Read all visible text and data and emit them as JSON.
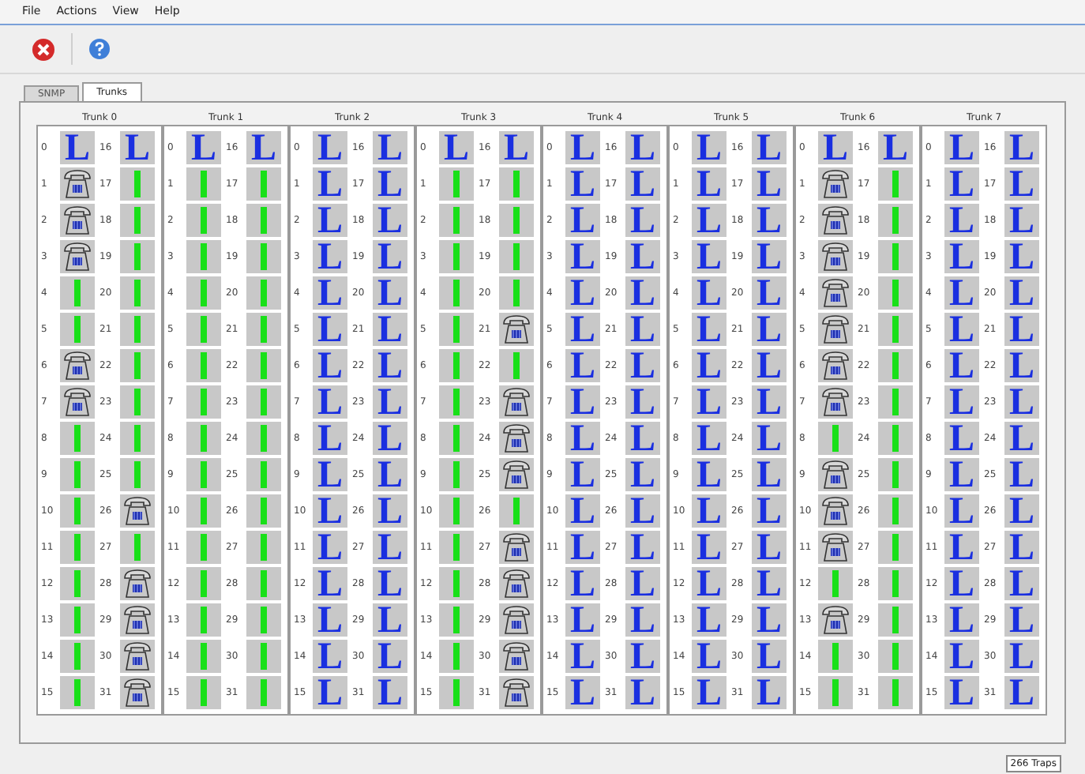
{
  "menu": [
    "File",
    "Actions",
    "View",
    "Help"
  ],
  "tabs": [
    {
      "label": "SNMP",
      "selected": false
    },
    {
      "label": "Trunks",
      "selected": true
    }
  ],
  "trunks": [
    {
      "name": "Trunk 0",
      "channels": [
        {
          "number": "0",
          "kind": "blocked",
          "glyph": "L"
        },
        {
          "number": "1",
          "kind": "phone"
        },
        {
          "number": "2",
          "kind": "phone"
        },
        {
          "number": "3",
          "kind": "phone"
        },
        {
          "number": "4",
          "kind": "idle"
        },
        {
          "number": "5",
          "kind": "idle"
        },
        {
          "number": "6",
          "kind": "phone"
        },
        {
          "number": "7",
          "kind": "phone"
        },
        {
          "number": "8",
          "kind": "idle"
        },
        {
          "number": "9",
          "kind": "idle"
        },
        {
          "number": "10",
          "kind": "idle"
        },
        {
          "number": "11",
          "kind": "idle"
        },
        {
          "number": "12",
          "kind": "idle"
        },
        {
          "number": "13",
          "kind": "idle"
        },
        {
          "number": "14",
          "kind": "idle"
        },
        {
          "number": "15",
          "kind": "idle"
        },
        {
          "number": "16",
          "kind": "blocked",
          "glyph": "L"
        },
        {
          "number": "17",
          "kind": "idle"
        },
        {
          "number": "18",
          "kind": "idle"
        },
        {
          "number": "19",
          "kind": "idle"
        },
        {
          "number": "20",
          "kind": "idle"
        },
        {
          "number": "21",
          "kind": "idle"
        },
        {
          "number": "22",
          "kind": "idle"
        },
        {
          "number": "23",
          "kind": "idle"
        },
        {
          "number": "24",
          "kind": "idle"
        },
        {
          "number": "25",
          "kind": "idle"
        },
        {
          "number": "26",
          "kind": "phone"
        },
        {
          "number": "27",
          "kind": "idle"
        },
        {
          "number": "28",
          "kind": "phone"
        },
        {
          "number": "29",
          "kind": "phone"
        },
        {
          "number": "30",
          "kind": "phone"
        },
        {
          "number": "31",
          "kind": "phone"
        }
      ]
    },
    {
      "name": "Trunk 1",
      "channels": [
        {
          "number": "0",
          "kind": "blocked",
          "glyph": "L"
        },
        {
          "number": "1",
          "kind": "idle"
        },
        {
          "number": "2",
          "kind": "idle"
        },
        {
          "number": "3",
          "kind": "idle"
        },
        {
          "number": "4",
          "kind": "idle"
        },
        {
          "number": "5",
          "kind": "idle"
        },
        {
          "number": "6",
          "kind": "idle"
        },
        {
          "number": "7",
          "kind": "idle"
        },
        {
          "number": "8",
          "kind": "idle"
        },
        {
          "number": "9",
          "kind": "idle"
        },
        {
          "number": "10",
          "kind": "idle"
        },
        {
          "number": "11",
          "kind": "idle"
        },
        {
          "number": "12",
          "kind": "idle"
        },
        {
          "number": "13",
          "kind": "idle"
        },
        {
          "number": "14",
          "kind": "idle"
        },
        {
          "number": "15",
          "kind": "idle"
        },
        {
          "number": "16",
          "kind": "blocked",
          "glyph": "L"
        },
        {
          "number": "17",
          "kind": "idle"
        },
        {
          "number": "18",
          "kind": "idle"
        },
        {
          "number": "19",
          "kind": "idle"
        },
        {
          "number": "20",
          "kind": "idle"
        },
        {
          "number": "21",
          "kind": "idle"
        },
        {
          "number": "22",
          "kind": "idle"
        },
        {
          "number": "23",
          "kind": "idle"
        },
        {
          "number": "24",
          "kind": "idle"
        },
        {
          "number": "25",
          "kind": "idle"
        },
        {
          "number": "26",
          "kind": "idle"
        },
        {
          "number": "27",
          "kind": "idle"
        },
        {
          "number": "28",
          "kind": "idle"
        },
        {
          "number": "29",
          "kind": "idle"
        },
        {
          "number": "30",
          "kind": "idle"
        },
        {
          "number": "31",
          "kind": "idle"
        }
      ]
    },
    {
      "name": "Trunk 2",
      "channels": [
        {
          "number": "0",
          "kind": "blocked",
          "glyph": "L"
        },
        {
          "number": "1",
          "kind": "blocked",
          "glyph": "L"
        },
        {
          "number": "2",
          "kind": "blocked",
          "glyph": "L"
        },
        {
          "number": "3",
          "kind": "blocked",
          "glyph": "L"
        },
        {
          "number": "4",
          "kind": "blocked",
          "glyph": "L"
        },
        {
          "number": "5",
          "kind": "blocked",
          "glyph": "L"
        },
        {
          "number": "6",
          "kind": "blocked",
          "glyph": "L"
        },
        {
          "number": "7",
          "kind": "blocked",
          "glyph": "L"
        },
        {
          "number": "8",
          "kind": "blocked",
          "glyph": "L"
        },
        {
          "number": "9",
          "kind": "blocked",
          "glyph": "L"
        },
        {
          "number": "10",
          "kind": "blocked",
          "glyph": "L"
        },
        {
          "number": "11",
          "kind": "blocked",
          "glyph": "L"
        },
        {
          "number": "12",
          "kind": "blocked",
          "glyph": "L"
        },
        {
          "number": "13",
          "kind": "blocked",
          "glyph": "L"
        },
        {
          "number": "14",
          "kind": "blocked",
          "glyph": "L"
        },
        {
          "number": "15",
          "kind": "blocked",
          "glyph": "L"
        },
        {
          "number": "16",
          "kind": "blocked",
          "glyph": "L"
        },
        {
          "number": "17",
          "kind": "blocked",
          "glyph": "L"
        },
        {
          "number": "18",
          "kind": "blocked",
          "glyph": "L"
        },
        {
          "number": "19",
          "kind": "blocked",
          "glyph": "L"
        },
        {
          "number": "20",
          "kind": "blocked",
          "glyph": "L"
        },
        {
          "number": "21",
          "kind": "blocked",
          "glyph": "L"
        },
        {
          "number": "22",
          "kind": "blocked",
          "glyph": "L"
        },
        {
          "number": "23",
          "kind": "blocked",
          "glyph": "L"
        },
        {
          "number": "24",
          "kind": "blocked",
          "glyph": "L"
        },
        {
          "number": "25",
          "kind": "blocked",
          "glyph": "L"
        },
        {
          "number": "26",
          "kind": "blocked",
          "glyph": "L"
        },
        {
          "number": "27",
          "kind": "blocked",
          "glyph": "L"
        },
        {
          "number": "28",
          "kind": "blocked",
          "glyph": "L"
        },
        {
          "number": "29",
          "kind": "blocked",
          "glyph": "L"
        },
        {
          "number": "30",
          "kind": "blocked",
          "glyph": "L"
        },
        {
          "number": "31",
          "kind": "blocked",
          "glyph": "L"
        }
      ]
    },
    {
      "name": "Trunk 3",
      "channels": [
        {
          "number": "0",
          "kind": "blocked",
          "glyph": "L"
        },
        {
          "number": "1",
          "kind": "idle"
        },
        {
          "number": "2",
          "kind": "idle"
        },
        {
          "number": "3",
          "kind": "idle"
        },
        {
          "number": "4",
          "kind": "idle"
        },
        {
          "number": "5",
          "kind": "idle"
        },
        {
          "number": "6",
          "kind": "idle"
        },
        {
          "number": "7",
          "kind": "idle"
        },
        {
          "number": "8",
          "kind": "idle"
        },
        {
          "number": "9",
          "kind": "idle"
        },
        {
          "number": "10",
          "kind": "idle"
        },
        {
          "number": "11",
          "kind": "idle"
        },
        {
          "number": "12",
          "kind": "idle"
        },
        {
          "number": "13",
          "kind": "idle"
        },
        {
          "number": "14",
          "kind": "idle"
        },
        {
          "number": "15",
          "kind": "idle"
        },
        {
          "number": "16",
          "kind": "blocked",
          "glyph": "L"
        },
        {
          "number": "17",
          "kind": "idle"
        },
        {
          "number": "18",
          "kind": "idle"
        },
        {
          "number": "19",
          "kind": "idle"
        },
        {
          "number": "20",
          "kind": "idle"
        },
        {
          "number": "21",
          "kind": "phone"
        },
        {
          "number": "22",
          "kind": "idle"
        },
        {
          "number": "23",
          "kind": "phone"
        },
        {
          "number": "24",
          "kind": "phone"
        },
        {
          "number": "25",
          "kind": "phone"
        },
        {
          "number": "26",
          "kind": "idle"
        },
        {
          "number": "27",
          "kind": "phone"
        },
        {
          "number": "28",
          "kind": "phone"
        },
        {
          "number": "29",
          "kind": "phone"
        },
        {
          "number": "30",
          "kind": "phone"
        },
        {
          "number": "31",
          "kind": "phone"
        }
      ]
    },
    {
      "name": "Trunk 4",
      "channels": [
        {
          "number": "0",
          "kind": "blocked",
          "glyph": "L"
        },
        {
          "number": "1",
          "kind": "blocked",
          "glyph": "L"
        },
        {
          "number": "2",
          "kind": "blocked",
          "glyph": "L"
        },
        {
          "number": "3",
          "kind": "blocked",
          "glyph": "L"
        },
        {
          "number": "4",
          "kind": "blocked",
          "glyph": "L"
        },
        {
          "number": "5",
          "kind": "blocked",
          "glyph": "L"
        },
        {
          "number": "6",
          "kind": "blocked",
          "glyph": "L"
        },
        {
          "number": "7",
          "kind": "blocked",
          "glyph": "L"
        },
        {
          "number": "8",
          "kind": "blocked",
          "glyph": "L"
        },
        {
          "number": "9",
          "kind": "blocked",
          "glyph": "L"
        },
        {
          "number": "10",
          "kind": "blocked",
          "glyph": "L"
        },
        {
          "number": "11",
          "kind": "blocked",
          "glyph": "L"
        },
        {
          "number": "12",
          "kind": "blocked",
          "glyph": "L"
        },
        {
          "number": "13",
          "kind": "blocked",
          "glyph": "L"
        },
        {
          "number": "14",
          "kind": "blocked",
          "glyph": "L"
        },
        {
          "number": "15",
          "kind": "blocked",
          "glyph": "L"
        },
        {
          "number": "16",
          "kind": "blocked",
          "glyph": "L"
        },
        {
          "number": "17",
          "kind": "blocked",
          "glyph": "L"
        },
        {
          "number": "18",
          "kind": "blocked",
          "glyph": "L"
        },
        {
          "number": "19",
          "kind": "blocked",
          "glyph": "L"
        },
        {
          "number": "20",
          "kind": "blocked",
          "glyph": "L"
        },
        {
          "number": "21",
          "kind": "blocked",
          "glyph": "L"
        },
        {
          "number": "22",
          "kind": "blocked",
          "glyph": "L"
        },
        {
          "number": "23",
          "kind": "blocked",
          "glyph": "L"
        },
        {
          "number": "24",
          "kind": "blocked",
          "glyph": "L"
        },
        {
          "number": "25",
          "kind": "blocked",
          "glyph": "L"
        },
        {
          "number": "26",
          "kind": "blocked",
          "glyph": "L"
        },
        {
          "number": "27",
          "kind": "blocked",
          "glyph": "L"
        },
        {
          "number": "28",
          "kind": "blocked",
          "glyph": "L"
        },
        {
          "number": "29",
          "kind": "blocked",
          "glyph": "L"
        },
        {
          "number": "30",
          "kind": "blocked",
          "glyph": "L"
        },
        {
          "number": "31",
          "kind": "blocked",
          "glyph": "L"
        }
      ]
    },
    {
      "name": "Trunk 5",
      "channels": [
        {
          "number": "0",
          "kind": "blocked",
          "glyph": "L"
        },
        {
          "number": "1",
          "kind": "blocked",
          "glyph": "L"
        },
        {
          "number": "2",
          "kind": "blocked",
          "glyph": "L"
        },
        {
          "number": "3",
          "kind": "blocked",
          "glyph": "L"
        },
        {
          "number": "4",
          "kind": "blocked",
          "glyph": "L"
        },
        {
          "number": "5",
          "kind": "blocked",
          "glyph": "L"
        },
        {
          "number": "6",
          "kind": "blocked",
          "glyph": "L"
        },
        {
          "number": "7",
          "kind": "blocked",
          "glyph": "L"
        },
        {
          "number": "8",
          "kind": "blocked",
          "glyph": "L"
        },
        {
          "number": "9",
          "kind": "blocked",
          "glyph": "L"
        },
        {
          "number": "10",
          "kind": "blocked",
          "glyph": "L"
        },
        {
          "number": "11",
          "kind": "blocked",
          "glyph": "L"
        },
        {
          "number": "12",
          "kind": "blocked",
          "glyph": "L"
        },
        {
          "number": "13",
          "kind": "blocked",
          "glyph": "L"
        },
        {
          "number": "14",
          "kind": "blocked",
          "glyph": "L"
        },
        {
          "number": "15",
          "kind": "blocked",
          "glyph": "L"
        },
        {
          "number": "16",
          "kind": "blocked",
          "glyph": "L"
        },
        {
          "number": "17",
          "kind": "blocked",
          "glyph": "L"
        },
        {
          "number": "18",
          "kind": "blocked",
          "glyph": "L"
        },
        {
          "number": "19",
          "kind": "blocked",
          "glyph": "L"
        },
        {
          "number": "20",
          "kind": "blocked",
          "glyph": "L"
        },
        {
          "number": "21",
          "kind": "blocked",
          "glyph": "L"
        },
        {
          "number": "22",
          "kind": "blocked",
          "glyph": "L"
        },
        {
          "number": "23",
          "kind": "blocked",
          "glyph": "L"
        },
        {
          "number": "24",
          "kind": "blocked",
          "glyph": "L"
        },
        {
          "number": "25",
          "kind": "blocked",
          "glyph": "L"
        },
        {
          "number": "26",
          "kind": "blocked",
          "glyph": "L"
        },
        {
          "number": "27",
          "kind": "blocked",
          "glyph": "L"
        },
        {
          "number": "28",
          "kind": "blocked",
          "glyph": "L"
        },
        {
          "number": "29",
          "kind": "blocked",
          "glyph": "L"
        },
        {
          "number": "30",
          "kind": "blocked",
          "glyph": "L"
        },
        {
          "number": "31",
          "kind": "blocked",
          "glyph": "L"
        }
      ]
    },
    {
      "name": "Trunk 6",
      "channels": [
        {
          "number": "0",
          "kind": "blocked",
          "glyph": "L"
        },
        {
          "number": "1",
          "kind": "phone"
        },
        {
          "number": "2",
          "kind": "phone"
        },
        {
          "number": "3",
          "kind": "phone"
        },
        {
          "number": "4",
          "kind": "phone"
        },
        {
          "number": "5",
          "kind": "phone"
        },
        {
          "number": "6",
          "kind": "phone"
        },
        {
          "number": "7",
          "kind": "phone"
        },
        {
          "number": "8",
          "kind": "idle"
        },
        {
          "number": "9",
          "kind": "phone"
        },
        {
          "number": "10",
          "kind": "phone"
        },
        {
          "number": "11",
          "kind": "phone"
        },
        {
          "number": "12",
          "kind": "idle"
        },
        {
          "number": "13",
          "kind": "phone"
        },
        {
          "number": "14",
          "kind": "idle"
        },
        {
          "number": "15",
          "kind": "idle"
        },
        {
          "number": "16",
          "kind": "blocked",
          "glyph": "L"
        },
        {
          "number": "17",
          "kind": "idle"
        },
        {
          "number": "18",
          "kind": "idle"
        },
        {
          "number": "19",
          "kind": "idle"
        },
        {
          "number": "20",
          "kind": "idle"
        },
        {
          "number": "21",
          "kind": "idle"
        },
        {
          "number": "22",
          "kind": "idle"
        },
        {
          "number": "23",
          "kind": "idle"
        },
        {
          "number": "24",
          "kind": "idle"
        },
        {
          "number": "25",
          "kind": "idle"
        },
        {
          "number": "26",
          "kind": "idle"
        },
        {
          "number": "27",
          "kind": "idle"
        },
        {
          "number": "28",
          "kind": "idle"
        },
        {
          "number": "29",
          "kind": "idle"
        },
        {
          "number": "30",
          "kind": "idle"
        },
        {
          "number": "31",
          "kind": "idle"
        }
      ]
    },
    {
      "name": "Trunk 7",
      "channels": [
        {
          "number": "0",
          "kind": "blocked",
          "glyph": "L"
        },
        {
          "number": "1",
          "kind": "blocked",
          "glyph": "L"
        },
        {
          "number": "2",
          "kind": "blocked",
          "glyph": "L"
        },
        {
          "number": "3",
          "kind": "blocked",
          "glyph": "L"
        },
        {
          "number": "4",
          "kind": "blocked",
          "glyph": "L"
        },
        {
          "number": "5",
          "kind": "blocked",
          "glyph": "L"
        },
        {
          "number": "6",
          "kind": "blocked",
          "glyph": "L"
        },
        {
          "number": "7",
          "kind": "blocked",
          "glyph": "L"
        },
        {
          "number": "8",
          "kind": "blocked",
          "glyph": "L"
        },
        {
          "number": "9",
          "kind": "blocked",
          "glyph": "L"
        },
        {
          "number": "10",
          "kind": "blocked",
          "glyph": "L"
        },
        {
          "number": "11",
          "kind": "blocked",
          "glyph": "L"
        },
        {
          "number": "12",
          "kind": "blocked",
          "glyph": "L"
        },
        {
          "number": "13",
          "kind": "blocked",
          "glyph": "L"
        },
        {
          "number": "14",
          "kind": "blocked",
          "glyph": "L"
        },
        {
          "number": "15",
          "kind": "blocked",
          "glyph": "L"
        },
        {
          "number": "16",
          "kind": "blocked",
          "glyph": "L"
        },
        {
          "number": "17",
          "kind": "blocked",
          "glyph": "L"
        },
        {
          "number": "18",
          "kind": "blocked",
          "glyph": "L"
        },
        {
          "number": "19",
          "kind": "blocked",
          "glyph": "L"
        },
        {
          "number": "20",
          "kind": "blocked",
          "glyph": "L"
        },
        {
          "number": "21",
          "kind": "blocked",
          "glyph": "L"
        },
        {
          "number": "22",
          "kind": "blocked",
          "glyph": "L"
        },
        {
          "number": "23",
          "kind": "blocked",
          "glyph": "L"
        },
        {
          "number": "24",
          "kind": "blocked",
          "glyph": "L"
        },
        {
          "number": "25",
          "kind": "blocked",
          "glyph": "L"
        },
        {
          "number": "26",
          "kind": "blocked",
          "glyph": "L"
        },
        {
          "number": "27",
          "kind": "blocked",
          "glyph": "L"
        },
        {
          "number": "28",
          "kind": "blocked",
          "glyph": "L"
        },
        {
          "number": "29",
          "kind": "blocked",
          "glyph": "L"
        },
        {
          "number": "30",
          "kind": "blocked",
          "glyph": "L"
        },
        {
          "number": "31",
          "kind": "blocked",
          "glyph": "L"
        }
      ]
    }
  ],
  "status": "266 Traps"
}
